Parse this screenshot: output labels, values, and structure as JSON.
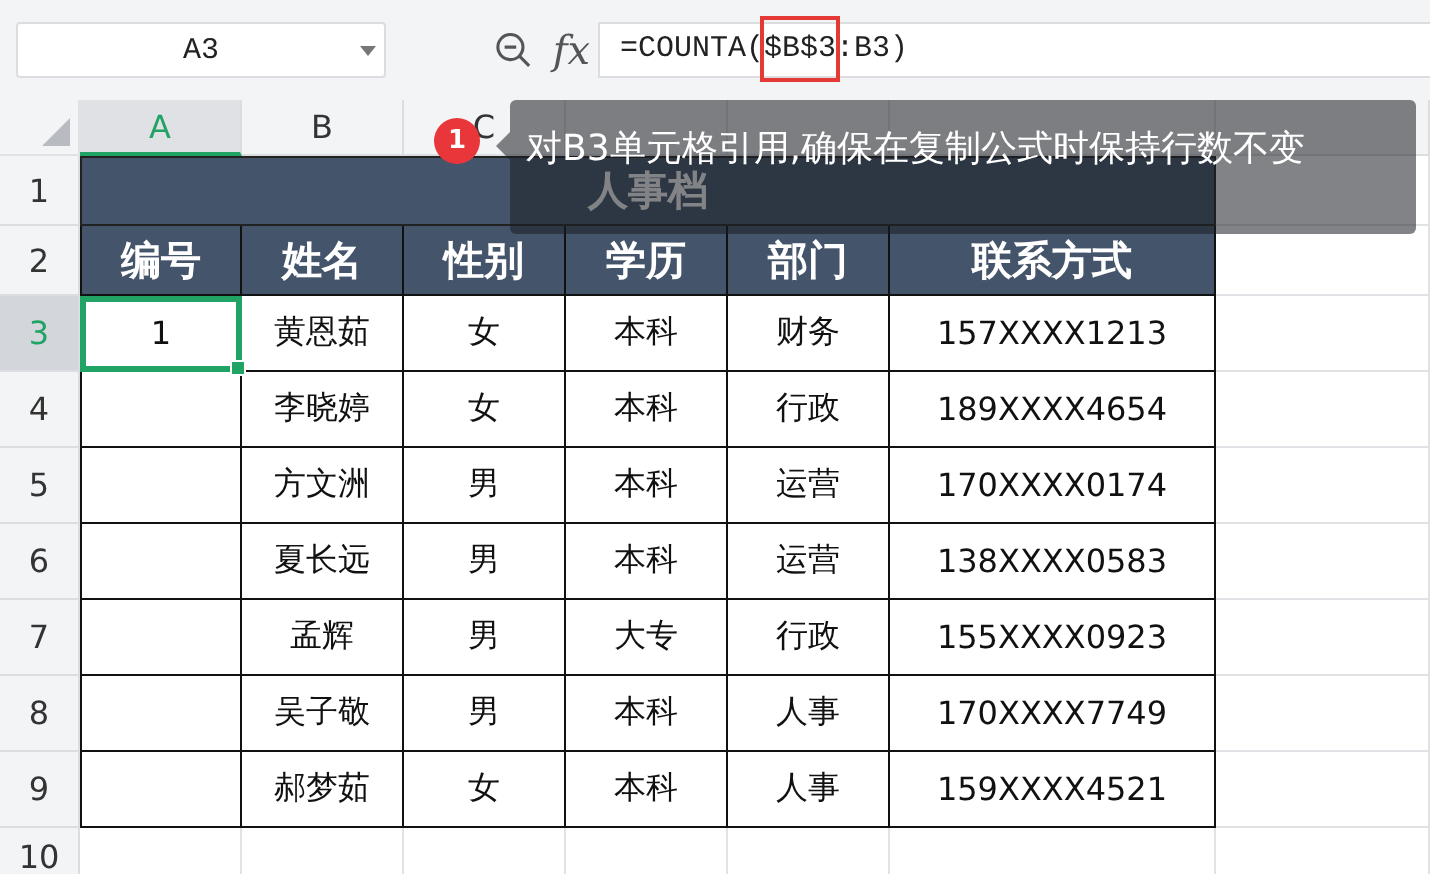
{
  "formula_bar": {
    "name_box": "A3",
    "fx_label": "fx",
    "formula": [
      {
        "text": "=COUNTA(",
        "highlighted": false
      },
      {
        "text": "$B$3",
        "highlighted": true
      },
      {
        "text": ":B3)",
        "highlighted": false
      }
    ]
  },
  "columns": [
    {
      "label": "A",
      "selected": true
    },
    {
      "label": "B",
      "selected": false
    },
    {
      "label": "C",
      "selected": false
    }
  ],
  "rows": [
    {
      "label": "1",
      "selected": false
    },
    {
      "label": "2",
      "selected": false
    },
    {
      "label": "3",
      "selected": true
    },
    {
      "label": "4",
      "selected": false
    },
    {
      "label": "5",
      "selected": false
    },
    {
      "label": "6",
      "selected": false
    },
    {
      "label": "7",
      "selected": false
    },
    {
      "label": "8",
      "selected": false
    },
    {
      "label": "9",
      "selected": false
    },
    {
      "label": "10",
      "selected": false
    }
  ],
  "sheet": {
    "title": "人事档",
    "headers": [
      "编号",
      "姓名",
      "性别",
      "学历",
      "部门",
      "联系方式"
    ],
    "records": [
      [
        {
          "text": "1",
          "selected": true
        },
        {
          "text": "黄恩茹",
          "selected": false
        },
        {
          "text": "女",
          "selected": false
        },
        {
          "text": "本科",
          "selected": false
        },
        {
          "text": "财务",
          "selected": false
        },
        {
          "text": "157XXXX1213",
          "selected": false
        }
      ],
      [
        {
          "selected": false
        },
        {
          "text": "李晓婷",
          "selected": false
        },
        {
          "text": "女",
          "selected": false
        },
        {
          "text": "本科",
          "selected": false
        },
        {
          "text": "行政",
          "selected": false
        },
        {
          "text": "189XXXX4654",
          "selected": false
        }
      ],
      [
        {
          "selected": false
        },
        {
          "text": "方文洲",
          "selected": false
        },
        {
          "text": "男",
          "selected": false
        },
        {
          "text": "本科",
          "selected": false
        },
        {
          "text": "运营",
          "selected": false
        },
        {
          "text": "170XXXX0174",
          "selected": false
        }
      ],
      [
        {
          "selected": false
        },
        {
          "text": "夏长远",
          "selected": false
        },
        {
          "text": "男",
          "selected": false
        },
        {
          "text": "本科",
          "selected": false
        },
        {
          "text": "运营",
          "selected": false
        },
        {
          "text": "138XXXX0583",
          "selected": false
        }
      ],
      [
        {
          "selected": false
        },
        {
          "text": "孟辉",
          "selected": false
        },
        {
          "text": "男",
          "selected": false
        },
        {
          "text": "大专",
          "selected": false
        },
        {
          "text": "行政",
          "selected": false
        },
        {
          "text": "155XXXX0923",
          "selected": false
        }
      ],
      [
        {
          "selected": false
        },
        {
          "text": "吴子敬",
          "selected": false
        },
        {
          "text": "男",
          "selected": false
        },
        {
          "text": "本科",
          "selected": false
        },
        {
          "text": "人事",
          "selected": false
        },
        {
          "text": "170XXXX7749",
          "selected": false
        }
      ],
      [
        {
          "selected": false
        },
        {
          "text": "郝梦茹",
          "selected": false
        },
        {
          "text": "女",
          "selected": false
        },
        {
          "text": "本科",
          "selected": false
        },
        {
          "text": "人事",
          "selected": false
        },
        {
          "text": "159XXXX4521",
          "selected": false
        }
      ]
    ]
  },
  "tooltip": {
    "badge": "1",
    "text": "对B3单元格引用,确保在复制公式时保持行数不变"
  }
}
